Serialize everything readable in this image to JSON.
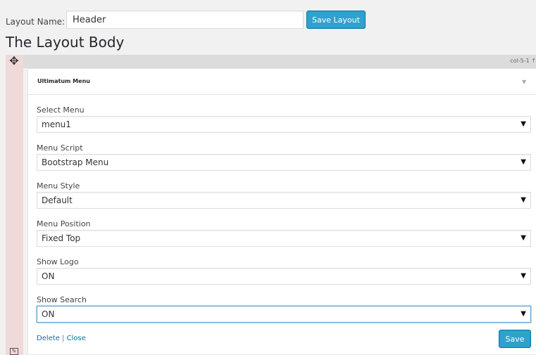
{
  "layout": {
    "name_label": "Layout Name:",
    "name_value": "Header",
    "save_label": "Save Layout"
  },
  "body_title": "The Layout Body",
  "column": {
    "label": "col-5-1 ↑"
  },
  "widget": {
    "title": "Ultimatum Menu",
    "toggle": "▼",
    "fields": [
      {
        "label": "Select Menu",
        "value": "menu1"
      },
      {
        "label": "Menu Script",
        "value": "Bootstrap Menu"
      },
      {
        "label": "Menu Style",
        "value": "Default"
      },
      {
        "label": "Menu Position",
        "value": "Fixed Top"
      },
      {
        "label": "Show Logo",
        "value": "ON"
      },
      {
        "label": "Show Search",
        "value": "ON"
      }
    ],
    "delete_label": "Delete",
    "separator": "|",
    "close_label": "Close",
    "save_label": "Save"
  },
  "icons": {
    "move": "move-icon",
    "edit": "edit-icon",
    "select_arrow": "▼"
  },
  "colors": {
    "primary_button": "#2ea2cc",
    "strip": "#f0d9d9",
    "link": "#0074a2"
  }
}
